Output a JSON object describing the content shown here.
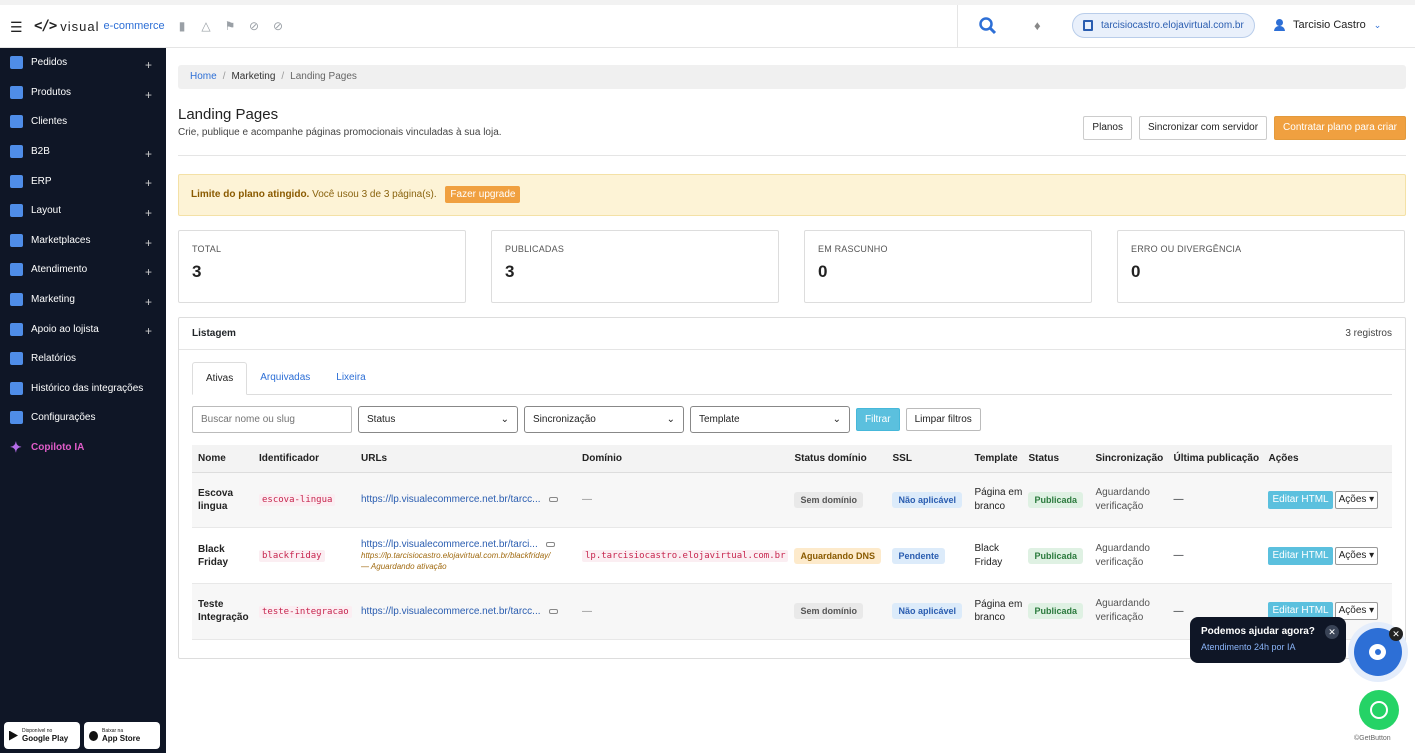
{
  "header": {
    "brand": "</>",
    "brand_text": "visual",
    "brand_text2": "e-commerce",
    "domain": "tarcisiocastro.elojavirtual.com.br",
    "user": "Tarcisio Castro"
  },
  "sidebar": {
    "items": [
      {
        "label": "Pedidos",
        "icon": "orders-icon",
        "plus": "+"
      },
      {
        "label": "Produtos",
        "icon": "products-icon",
        "plus": "+"
      },
      {
        "label": "Clientes",
        "icon": "customers-icon",
        "plus": ""
      },
      {
        "label": "B2B",
        "icon": "tags-icon",
        "plus": "+"
      },
      {
        "label": "ERP",
        "icon": "briefcase-icon",
        "plus": "+"
      },
      {
        "label": "Layout",
        "icon": "image-icon",
        "plus": "+"
      },
      {
        "label": "Marketplaces",
        "icon": "cart-icon",
        "plus": "+"
      },
      {
        "label": "Atendimento",
        "icon": "chat-icon",
        "plus": "+"
      },
      {
        "label": "Marketing",
        "icon": "megaphone-icon",
        "plus": "+"
      },
      {
        "label": "Apoio ao lojista",
        "icon": "cart-icon",
        "plus": "+"
      },
      {
        "label": "Relatórios",
        "icon": "report-icon",
        "plus": ""
      },
      {
        "label": "Histórico das integrações",
        "icon": "history-icon",
        "plus": ""
      },
      {
        "label": "Configurações",
        "icon": "gear-icon",
        "plus": ""
      },
      {
        "label": "Copiloto IA",
        "icon": "sparkle-icon",
        "plus": ""
      }
    ],
    "store_google_1": "Disponível no",
    "store_google_2": "Google Play",
    "store_apple_1": "Baixar na",
    "store_apple_2": "App Store"
  },
  "breadcrumb": {
    "home": "Home",
    "section": "Marketing",
    "current": "Landing Pages"
  },
  "page": {
    "title": "Landing Pages",
    "subtitle": "Crie, publique e acompanhe páginas promocionais vinculadas à sua loja.",
    "btn_planos": "Planos",
    "btn_sync": "Sincronizar com servidor",
    "btn_contratar": "Contratar plano para criar"
  },
  "alert": {
    "bold": "Limite do plano atingido.",
    "text": "Você usou 3 de 3 página(s).",
    "btn": "Fazer upgrade"
  },
  "stats": [
    {
      "label": "TOTAL",
      "value": "3"
    },
    {
      "label": "PUBLICADAS",
      "value": "3"
    },
    {
      "label": "EM RASCUNHO",
      "value": "0"
    },
    {
      "label": "ERRO OU DIVERGÊNCIA",
      "value": "0"
    }
  ],
  "listing": {
    "title": "Listagem",
    "count": "3 registros",
    "tabs": [
      "Ativas",
      "Arquivadas",
      "Lixeira"
    ],
    "search_placeholder": "Buscar nome ou slug",
    "status_select": "Status",
    "sync_select": "Sincronização",
    "template_select": "Template",
    "btn_filter": "Filtrar",
    "btn_clear": "Limpar filtros",
    "columns": [
      "Nome",
      "Identificador",
      "URLs",
      "Domínio",
      "Status domínio",
      "SSL",
      "Template",
      "Status",
      "Sincronização",
      "Última publicação",
      "Ações"
    ],
    "rows": [
      {
        "name": "Escova lingua",
        "slug": "escova-lingua",
        "url": "https://lp.visualecommerce.net.br/tarcc...",
        "url2": "",
        "url3": "",
        "domain": "—",
        "dstatus": "Sem domínio",
        "ssl": "Não aplicável",
        "template": "Página em branco",
        "status": "Publicada",
        "sync": "Aguardando verificação",
        "last": "—",
        "edit": "Editar HTML",
        "actions": "Ações ▾"
      },
      {
        "name": "Black Friday",
        "slug": "blackfriday",
        "url": "https://lp.visualecommerce.net.br/tarci...",
        "url2": "https://lp.tarcisiocastro.elojavirtual.com.br/blackfriday/",
        "url3": "— Aguardando ativação",
        "domain": "lp.tarcisiocastro.elojavirtual.com.br",
        "dstatus": "Aguardando DNS",
        "ssl": "Pendente",
        "template": "Black Friday",
        "status": "Publicada",
        "sync": "Aguardando verificação",
        "last": "—",
        "edit": "Editar HTML",
        "actions": "Ações ▾"
      },
      {
        "name": "Teste Integração",
        "slug": "teste-integracao",
        "url": "https://lp.visualecommerce.net.br/tarcc...",
        "url2": "",
        "url3": "",
        "domain": "—",
        "dstatus": "Sem domínio",
        "ssl": "Não aplicável",
        "template": "Página em branco",
        "status": "Publicada",
        "sync": "Aguardando verificação",
        "last": "—",
        "edit": "Editar HTML",
        "actions": "Ações ▾"
      }
    ]
  },
  "chat": {
    "question": "Podemos ajudar agora?",
    "sub": "Atendimento 24h por IA",
    "getbutton": "GetButton"
  }
}
